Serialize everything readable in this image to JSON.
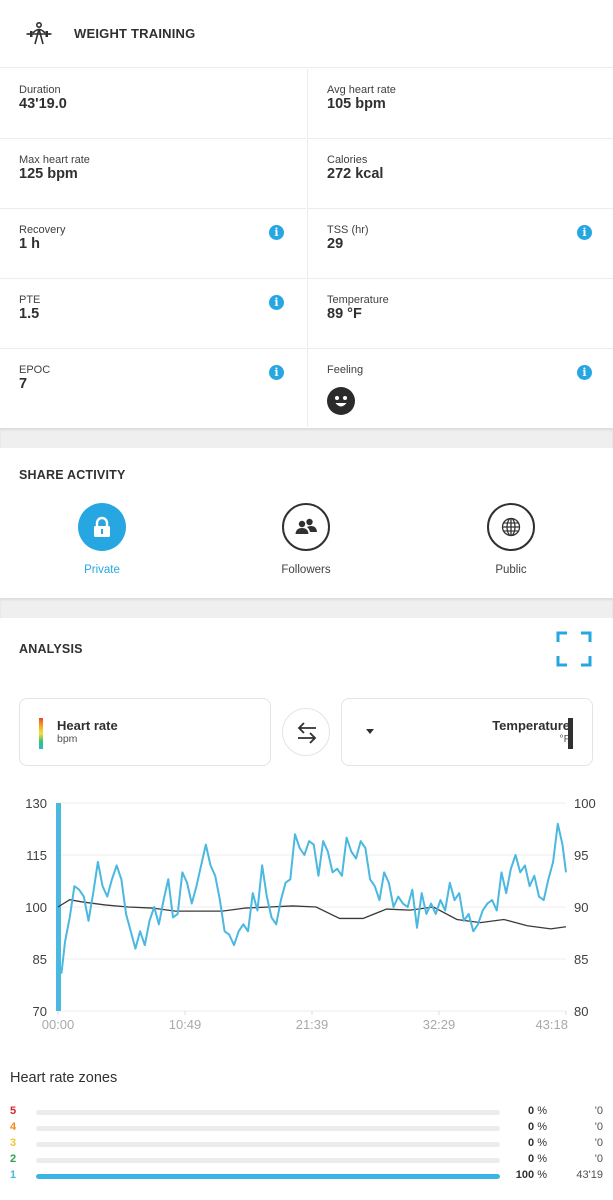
{
  "header": {
    "title": "WEIGHT TRAINING",
    "icon": "weightlifting-icon"
  },
  "stats": [
    {
      "label": "Duration",
      "value": "43'19.0",
      "info": false
    },
    {
      "label": "Avg heart rate",
      "value": "105 bpm",
      "info": false
    },
    {
      "label": "Max heart rate",
      "value": "125 bpm",
      "info": false
    },
    {
      "label": "Calories",
      "value": "272 kcal",
      "info": false
    },
    {
      "label": "Recovery",
      "value": "1 h",
      "info": true
    },
    {
      "label": "TSS (hr)",
      "value": "29",
      "info": true
    },
    {
      "label": "PTE",
      "value": "1.5",
      "info": true
    },
    {
      "label": "Temperature",
      "value": "89 °F",
      "info": false
    },
    {
      "label": "EPOC",
      "value": "7",
      "info": true
    },
    {
      "label": "Feeling",
      "value": "",
      "icon": "smiley-face-icon",
      "info": true
    }
  ],
  "info_glyph": "i",
  "share": {
    "title": "SHARE ACTIVITY",
    "options": [
      {
        "label": "Private",
        "icon": "lock-icon",
        "selected": true
      },
      {
        "label": "Followers",
        "icon": "followers-icon",
        "selected": false
      },
      {
        "label": "Public",
        "icon": "globe-icon",
        "selected": false
      }
    ]
  },
  "analysis": {
    "title": "ANALYSIS",
    "primary": {
      "name": "Heart rate",
      "unit": "bpm"
    },
    "secondary": {
      "name": "Temperature",
      "unit": "°F"
    }
  },
  "colors": {
    "accent": "#27a7e2",
    "heart_rate_line": "#4ab8e0",
    "temperature_line": "#3a3a3a",
    "zone5": "#d0262d",
    "zone4": "#f08a1c",
    "zone3": "#f3c53a",
    "zone2": "#2aa24a",
    "zone1": "#4ab8e0"
  },
  "chart_data": {
    "type": "line",
    "title": "",
    "xlabel": "",
    "x_ticks": [
      "00:00",
      "10:49",
      "21:39",
      "32:29",
      "43:18"
    ],
    "x_range_minutes": [
      0,
      43.3
    ],
    "y_left": {
      "label": "Heart rate (bpm)",
      "ticks": [
        70,
        85,
        100,
        115,
        130
      ],
      "range": [
        70,
        130
      ]
    },
    "y_right": {
      "label": "Temperature (°F)",
      "ticks": [
        80,
        85,
        90,
        95,
        100
      ],
      "range": [
        80,
        100
      ]
    },
    "grid": true,
    "series": [
      {
        "name": "Heart rate",
        "axis": "left",
        "x": [
          0,
          0.3,
          0.6,
          1.0,
          1.4,
          1.8,
          2.2,
          2.6,
          3.0,
          3.4,
          3.8,
          4.2,
          4.6,
          5.0,
          5.4,
          5.8,
          6.2,
          6.6,
          7.0,
          7.4,
          7.8,
          8.2,
          8.6,
          9.0,
          9.4,
          9.8,
          10.2,
          10.6,
          11.0,
          11.4,
          11.8,
          12.2,
          12.6,
          13.0,
          13.4,
          13.8,
          14.2,
          14.6,
          15.0,
          15.4,
          15.8,
          16.2,
          16.6,
          17.0,
          17.4,
          17.8,
          18.2,
          18.6,
          19.0,
          19.4,
          19.8,
          20.2,
          20.6,
          21.0,
          21.4,
          21.8,
          22.2,
          22.6,
          23.0,
          23.4,
          23.8,
          24.2,
          24.6,
          25.0,
          25.4,
          25.8,
          26.2,
          26.6,
          27.0,
          27.4,
          27.8,
          28.2,
          28.6,
          29.0,
          29.4,
          29.8,
          30.2,
          30.6,
          31.0,
          31.4,
          31.8,
          32.2,
          32.6,
          33.0,
          33.4,
          33.8,
          34.2,
          34.6,
          35.0,
          35.4,
          35.8,
          36.2,
          36.6,
          37.0,
          37.4,
          37.8,
          38.2,
          38.6,
          39.0,
          39.4,
          39.8,
          40.2,
          40.6,
          41.0,
          41.4,
          41.8,
          42.2,
          42.6,
          43.0,
          43.3
        ],
        "values": [
          85,
          81,
          90,
          97,
          106,
          105,
          103,
          96,
          104,
          113,
          106,
          103,
          108,
          112,
          108,
          98,
          93,
          88,
          93,
          89,
          96,
          100,
          95,
          102,
          108,
          97,
          98,
          110,
          107,
          101,
          106,
          112,
          118,
          112,
          109,
          102,
          93,
          92,
          89,
          93,
          95,
          93,
          104,
          99,
          112,
          103,
          97,
          95,
          102,
          107,
          108,
          121,
          117,
          115,
          119,
          118,
          109,
          119,
          116,
          110,
          111,
          109,
          120,
          116,
          114,
          119,
          117,
          108,
          106,
          102,
          110,
          107,
          100,
          103,
          101,
          100,
          105,
          94,
          104,
          98,
          101,
          98,
          102,
          99,
          107,
          102,
          104,
          96,
          98,
          93,
          95,
          99,
          101,
          102,
          99,
          110,
          104,
          111,
          115,
          110,
          112,
          106,
          109,
          103,
          102,
          108,
          113,
          124,
          118,
          110,
          106,
          105,
          99,
          98
        ],
        "unit": "bpm"
      },
      {
        "name": "Temperature",
        "axis": "right",
        "x": [
          0,
          1,
          2,
          4,
          6,
          8,
          10,
          12,
          14,
          16,
          18,
          20,
          22,
          24,
          26,
          28,
          30,
          32,
          34,
          36,
          38,
          40,
          42,
          43.3
        ],
        "values": [
          90,
          90.7,
          90.5,
          90.2,
          90.0,
          89.9,
          89.6,
          89.6,
          89.6,
          89.9,
          90.0,
          90.1,
          90.0,
          88.9,
          88.9,
          89.8,
          89.7,
          90.0,
          88.8,
          88.5,
          88.8,
          88.2,
          87.9,
          88.1
        ],
        "unit": "°F"
      }
    ]
  },
  "zones": {
    "title": "Heart rate zones",
    "items": [
      {
        "zone": "5",
        "percent": 0,
        "percent_label": "0 %",
        "time": "'0"
      },
      {
        "zone": "4",
        "percent": 0,
        "percent_label": "0 %",
        "time": "'0"
      },
      {
        "zone": "3",
        "percent": 0,
        "percent_label": "0 %",
        "time": "'0"
      },
      {
        "zone": "2",
        "percent": 0,
        "percent_label": "0 %",
        "time": "'0"
      },
      {
        "zone": "1",
        "percent": 100,
        "percent_label": "100 %",
        "time": "43'19"
      }
    ]
  }
}
